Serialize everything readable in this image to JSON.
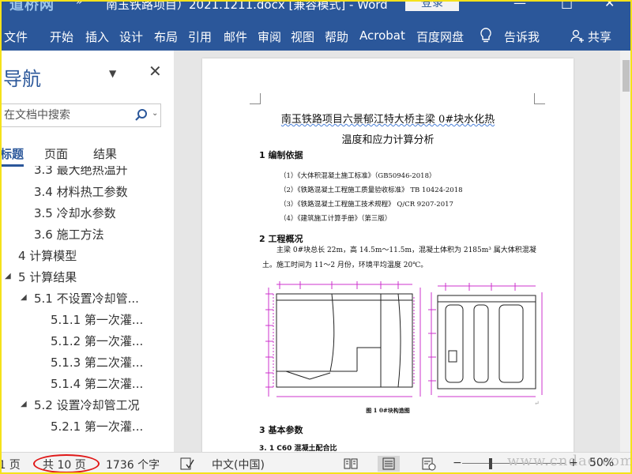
{
  "titlebar": {
    "logo": "道桥网",
    "quick_access": "»",
    "title": "南玉铁路项目）2021.1211.docx [兼容模式] - Word",
    "login_button": "登录",
    "minimize": "—",
    "maximize": "□",
    "close": "✕"
  },
  "ribbon": {
    "tabs": [
      "文件",
      "开始",
      "插入",
      "设计",
      "布局",
      "引用",
      "邮件",
      "审阅",
      "视图",
      "帮助",
      "Acrobat",
      "百度网盘"
    ],
    "tell_me": "告诉我",
    "share": "共享"
  },
  "nav": {
    "title": "导航",
    "menu_icon": "▼",
    "close_icon": "✕",
    "search_placeholder": "在文档中搜索",
    "search_dropdown": "⌄",
    "tabs": [
      "标题",
      "页面",
      "结果"
    ],
    "items": [
      {
        "label": "3.3 最大绝热温升"
      },
      {
        "label": "3.4 材料热工参数"
      },
      {
        "label": "3.5 冷却水参数"
      },
      {
        "label": "3.6 施工方法"
      },
      {
        "label": "4 计算模型"
      },
      {
        "label": "5 计算结果"
      },
      {
        "label": "5.1 不设置冷却管..."
      },
      {
        "label": "5.1.1 第一次灌..."
      },
      {
        "label": "5.1.2 第一次灌..."
      },
      {
        "label": "5.1.3 第二次灌..."
      },
      {
        "label": "5.1.4 第二次灌..."
      },
      {
        "label": "5.2 设置冷却管工况"
      },
      {
        "label": "5.2.1 第一次灌..."
      }
    ]
  },
  "document": {
    "title_line1": "南玉铁路项目六景郁江特大桥主梁 0#块水化热",
    "title_line2": "温度和应力计算分析",
    "sec1": "1 编制依据",
    "refs": [
      "（1）《大体积混凝土施工标准》（GB50946-2018）",
      "（2）《铁路混凝土工程施工质量验收标准》 TB 10424-2018",
      "（3）《铁路混凝土工程施工技术规程》 Q/CR 9207-2017",
      "（4）《建筑施工计算手册》（第三版）"
    ],
    "sec2": "2 工程概况",
    "para": "主梁 0#块总长 22m，高 14.5m～11.5m，混凝土体积为 2185m³ 属大体积混凝土。施工时间为 11～2 月份，环境平均温度 20℃。",
    "figure_caption": "图 1 0#块构造图",
    "sec3": "3 基本参数",
    "sec31": "3. 1 C60 混凝土配合比",
    "para_mark": "↵"
  },
  "status": {
    "page": "第 1 页",
    "total_pages": "共 10 页",
    "words": "1736 个字",
    "language": "中文(中国)",
    "zoom_minus": "−",
    "zoom_plus": "+",
    "zoom": "50%",
    "watermark": "www.cndao.com"
  },
  "colors": {
    "ribbon": "#2b579a",
    "highlight_oval": "#e01818",
    "frame": "#f5e21a",
    "drawing_magenta": "#cc33cc"
  }
}
